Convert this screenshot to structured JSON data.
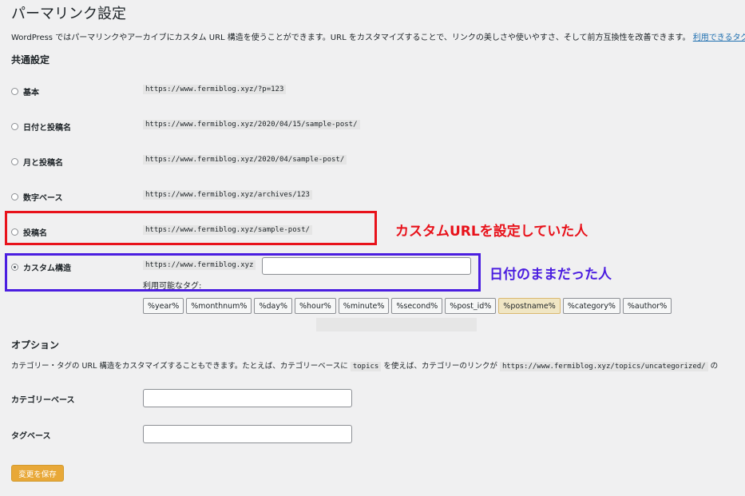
{
  "page": {
    "title": "パーマリンク設定",
    "intro": "WordPress ではパーマリンクやアーカイブにカスタム URL 構造を使うことができます。URL をカスタマイズすることで、リンクの美しさや使いやすさ、そして前方互換性を改善できます。",
    "intro_link": "利用できるタグは"
  },
  "common": {
    "heading": "共通設定",
    "options": [
      {
        "label": "基本",
        "example": "https://www.fermiblog.xyz/?p=123",
        "checked": false
      },
      {
        "label": "日付と投稿名",
        "example": "https://www.fermiblog.xyz/2020/04/15/sample-post/",
        "checked": false
      },
      {
        "label": "月と投稿名",
        "example": "https://www.fermiblog.xyz/2020/04/sample-post/",
        "checked": false
      },
      {
        "label": "数字ベース",
        "example": "https://www.fermiblog.xyz/archives/123",
        "checked": false
      },
      {
        "label": "投稿名",
        "example": "https://www.fermiblog.xyz/sample-post/",
        "checked": false
      },
      {
        "label": "カスタム構造",
        "example": "https://www.fermiblog.xyz",
        "checked": true
      }
    ],
    "custom_value": "",
    "available_tags_label": "利用可能なタグ:",
    "tags": [
      "%year%",
      "%monthnum%",
      "%day%",
      "%hour%",
      "%minute%",
      "%second%",
      "%post_id%",
      "%postname%",
      "%category%",
      "%author%"
    ],
    "active_tag": "%postname%"
  },
  "annotations": {
    "red_note": "カスタムURLを設定していた人",
    "blue_note": "日付のままだった人",
    "red_color": "#e8121b",
    "blue_color": "#4b1ee0"
  },
  "optional": {
    "heading": "オプション",
    "desc_before": "カテゴリー・タグの URL 構造をカスタマイズすることもできます。たとえば、カテゴリーベースに",
    "desc_code1": "topics",
    "desc_mid": "を使えば、カテゴリーのリンクが",
    "desc_code2": "https://www.fermiblog.xyz/topics/uncategorized/",
    "desc_after": "の",
    "category_base_label": "カテゴリーベース",
    "category_base_value": "",
    "tag_base_label": "タグベース",
    "tag_base_value": ""
  },
  "save_button": "変更を保存",
  "colors": {
    "accent": "#2271b1",
    "save": "#e8a838"
  }
}
